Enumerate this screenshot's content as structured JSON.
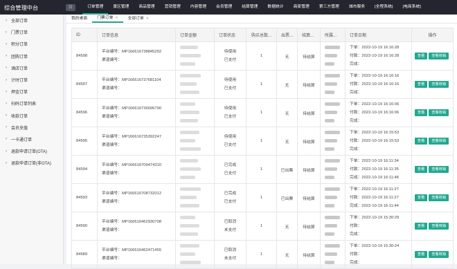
{
  "header": {
    "brand": "综合管理中台",
    "menu_icon": "grid-icon",
    "nav": [
      "订单管理",
      "景区管理",
      "商品管理",
      "营销管理",
      "内容管理",
      "会员管理",
      "结算管理",
      "数据统计",
      "商家管理",
      "第三方管理",
      "城市服务",
      "[全程系统]",
      "[电商系统]"
    ]
  },
  "sidebar": {
    "items": [
      "全部订单",
      "门票订单",
      "积分订单",
      "团购订单",
      "酒店订单",
      "计时订单",
      "押金订单",
      "扫码订单列表",
      "收款订单",
      "会员充值",
      "一卡通订单",
      "退款申请订单(OTA)",
      "退款申请订单(非OTA)"
    ]
  },
  "tabs": [
    {
      "label": "我的桌面",
      "active": false
    },
    {
      "label": "门票订单",
      "active": true
    },
    {
      "label": "全部订单",
      "active": false
    }
  ],
  "table": {
    "headers": [
      "ID",
      "订单信息",
      "订单金额",
      "订单状态",
      "购买总数...",
      "出票...",
      "结算...",
      "所属...",
      "订单日期",
      "操作"
    ],
    "platform_label": "平台编号：",
    "channel_label": "渠道编号：",
    "order_prefix": "下单：",
    "pay_prefix": "付款：",
    "done_prefix": "完成：",
    "view_btn": "查看",
    "verify_btn": "查看核销",
    "rows": [
      {
        "id": "84598",
        "platform_no": "MP166616738845292",
        "status1": "待使用",
        "status2": "已支付",
        "qty": "1",
        "ticket": "无",
        "settle": "待结算",
        "order_time": "2022-10-19 16:16:28",
        "pay_time": "2022-10-19 16:16:28",
        "done_time": "",
        "has_verify": true
      },
      {
        "id": "84597",
        "platform_no": "MP166616737681104",
        "status1": "待使用",
        "status2": "已支付",
        "qty": "1",
        "ticket": "无",
        "settle": "待结算",
        "order_time": "2022-10-19 16:16:16",
        "pay_time": "2022-10-19 16:16:16",
        "done_time": "",
        "has_verify": true
      },
      {
        "id": "84596",
        "platform_no": "MP166616736696790",
        "status1": "待使用",
        "status2": "已支付",
        "qty": "1",
        "ticket": "无",
        "settle": "待结算",
        "order_time": "2022-10-19 16:16:06",
        "pay_time": "2022-10-19 16:16:06",
        "done_time": "",
        "has_verify": true
      },
      {
        "id": "84595",
        "platform_no": "MP166616735392247",
        "status1": "待使用",
        "status2": "已支付",
        "qty": "1",
        "ticket": "无",
        "settle": "待结算",
        "order_time": "2022-10-19 16:15:53",
        "pay_time": "2022-10-19 16:15:53",
        "done_time": "",
        "has_verify": true
      },
      {
        "id": "84594",
        "platform_no": "MP166616709474310",
        "status1": "已完成",
        "status2": "已支付",
        "qty": "1",
        "ticket": "已出票",
        "settle": "待结算",
        "order_time": "2022-10-19 16:11:34",
        "pay_time": "2022-10-19 16:11:35",
        "done_time": "2022-10-19 16:11:48",
        "has_verify": true
      },
      {
        "id": "84593",
        "platform_no": "MP166616708732012",
        "status1": "已完成",
        "status2": "已支付",
        "qty": "1",
        "ticket": "已出票",
        "settle": "待结算",
        "order_time": "2022-10-19 16:11:27",
        "pay_time": "2022-10-19 16:11:27",
        "done_time": "2022-10-19 16:11:44",
        "has_verify": true
      },
      {
        "id": "84590",
        "platform_no": "MP166616462930708",
        "status1": "已取消",
        "status2": "未支付",
        "qty": "1",
        "ticket": "无",
        "settle": "待结算",
        "order_time": "2022-10-19 15:30:29",
        "pay_time": "",
        "done_time": "",
        "has_verify": true
      },
      {
        "id": "84589",
        "platform_no": "MP166616462471455",
        "status1": "已取消",
        "status2": "未支付",
        "qty": "1",
        "ticket": "无",
        "settle": "待结算",
        "order_time": "2022-10-19 15:30:24",
        "pay_time": "",
        "done_time": "",
        "has_verify": true
      }
    ]
  },
  "colors": {
    "accent": "#22a88f",
    "topbar": "#23262e"
  }
}
